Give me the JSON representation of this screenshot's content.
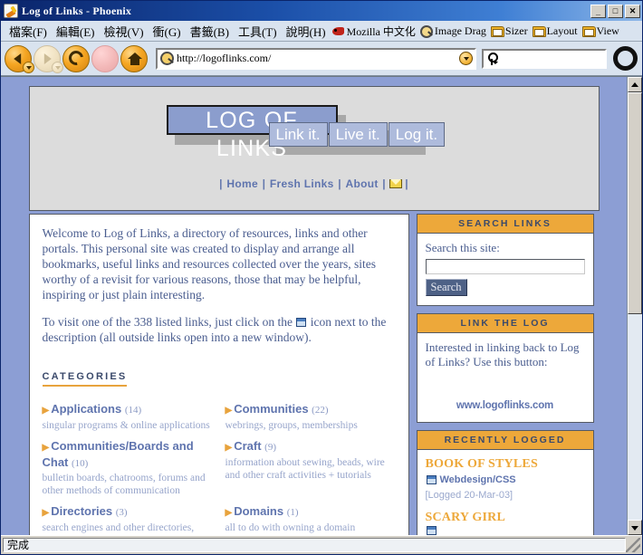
{
  "window": {
    "title": "Log of Links - Phoenix",
    "minimize_label": "_",
    "maximize_label": "□",
    "close_label": "✕"
  },
  "menubar": {
    "items": [
      {
        "label": "檔案(F)"
      },
      {
        "label": "編輯(E)"
      },
      {
        "label": "檢視(V)"
      },
      {
        "label": "衝(G)"
      },
      {
        "label": "書籤(B)"
      },
      {
        "label": "工具(T)"
      },
      {
        "label": "說明(H)"
      }
    ],
    "extensions": [
      {
        "label": "Mozilla 中文化",
        "icon": "dragon-icon"
      },
      {
        "label": "Image Drag",
        "icon": "magnifier-icon"
      },
      {
        "label": "Sizer",
        "icon": "folder-icon"
      },
      {
        "label": "Layout",
        "icon": "folder-icon"
      },
      {
        "label": "View",
        "icon": "folder-icon"
      }
    ]
  },
  "toolbar": {
    "back_label": "Back",
    "forward_label": "Forward",
    "reload_label": "Reload",
    "stop_label": "Stop",
    "home_label": "Home",
    "url": "http://logoflinks.com/",
    "search_value": "",
    "search_placeholder": ""
  },
  "page": {
    "logo": "LOG OF LINKS",
    "tagline": [
      "Link it.",
      "Live it.",
      "Log it."
    ],
    "nav": {
      "sep": "|",
      "items": [
        "Home",
        "Fresh Links",
        "About"
      ],
      "mail_label": "✉"
    },
    "intro": {
      "p1": "Welcome to Log of Links, a directory of resources, links and other portals. This personal site was created to display and arrange all bookmarks, useful links and resources collected over the years, sites worthy of a revisit for various reasons, those that may be helpful, inspiring or just plain interesting.",
      "p2_before": "To visit one of the 338 listed links, just click on the",
      "p2_after": "icon next to the description (all outside links open into a new window).",
      "link_count": "338"
    },
    "categories_heading": "CATEGORIES",
    "categories": [
      {
        "name": "Applications",
        "count": "(14)",
        "desc": "singular programs & online applications"
      },
      {
        "name": "Communities",
        "count": "(22)",
        "desc": "webrings, groups, memberships"
      },
      {
        "name": "Communities/Boards and Chat",
        "count": "(10)",
        "desc": "bulletin boards, chatrooms, forums and other methods of communication"
      },
      {
        "name": "Craft",
        "count": "(9)",
        "desc": "information about sewing, beads, wire and other craft activities + tutorials"
      },
      {
        "name": "Directories",
        "count": "(3)",
        "desc": "search engines and other directories, specific or general"
      },
      {
        "name": "Domains",
        "count": "(1)",
        "desc": "all to do with owning a domain"
      }
    ],
    "sidebar": {
      "search_box": {
        "heading": "SEARCH LINKS",
        "label": "Search this site:",
        "input_value": "",
        "button_label": "Search"
      },
      "link_box": {
        "heading": "LINK THE LOG",
        "text": "Interested in linking back to Log of Links? Use this button:",
        "button_url": "www.logoflinks.com"
      },
      "recent_box": {
        "heading": "RECENTLY LOGGED",
        "entries": [
          {
            "title": "BOOK OF STYLES",
            "category": "Webdesign/CSS",
            "logged": "[Logged 20-Mar-03]"
          },
          {
            "title": "SCARY GIRL",
            "category": "",
            "logged": ""
          }
        ]
      }
    }
  },
  "statusbar": {
    "text": "完成"
  }
}
